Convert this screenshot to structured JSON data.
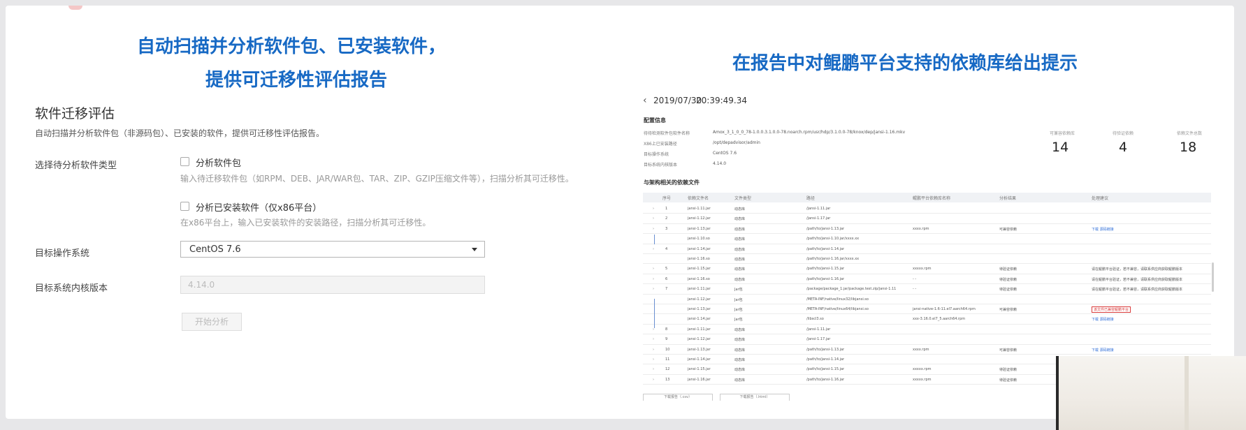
{
  "slide": {
    "left_headline_line1": "自动扫描并分析软件包、已安装软件，",
    "left_headline_line2": "提供可迁移性评估报告",
    "right_headline": "在报告中对鲲鹏平台支持的依赖库给出提示"
  },
  "form": {
    "title": "软件迁移评估",
    "description": "自动扫描并分析软件包（非源码包）、已安装的软件，提供可迁移性评估报告。",
    "type_label": "选择待分析软件类型",
    "option1_label": "分析软件包",
    "option1_hint": "输入待迁移软件包（如RPM、DEB、JAR/WAR包、TAR、ZIP、GZIP压缩文件等），扫描分析其可迁移性。",
    "option2_label": "分析已安装软件（仅x86平台）",
    "option2_hint": "在x86平台上，输入已安装软件的安装路径，扫描分析其可迁移性。",
    "os_label": "目标操作系统",
    "os_value": "CentOS 7.6",
    "kernel_label": "目标系统内核版本",
    "kernel_value": "4.14.0",
    "start_button": "开始分析"
  },
  "report": {
    "date": "2019/07/30",
    "time": "20:39:49.34",
    "config_title": "配置信息",
    "config": [
      {
        "label": "待待检测软件包软件名称",
        "value": "Amox_3_1_0_0_78-1.0.0.3.1.0.0-78.noarch.rpm/usr/hdp/3.1.0.0-78/knox/dep/jansi-1.16.mkv"
      },
      {
        "label": "X86上已安装路径",
        "value": "/opt/depadvisor/admin"
      },
      {
        "label": "目标操作系统",
        "value": "CentOS 7.6"
      },
      {
        "label": "目标系统内核版本",
        "value": "4.14.0"
      }
    ],
    "stats": [
      {
        "label": "可兼容依赖库",
        "value": "14"
      },
      {
        "label": "待验证依赖",
        "value": "4"
      },
      {
        "label": "依赖文件总数",
        "value": "18"
      }
    ],
    "table_title": "与架构相关的依赖文件",
    "columns": [
      "序号",
      "依赖文件名",
      "文件类型",
      "路径",
      "鲲鹏平台依赖库名称",
      "分析结果",
      "处理建议"
    ],
    "rows": [
      {
        "no": "1",
        "name": "jansi-1.11.jar",
        "type": "动态库",
        "path": "/jansi-1.11.jar",
        "lib": "",
        "result": "",
        "advice": ""
      },
      {
        "no": "2",
        "name": "jansi-1.12.jar",
        "type": "动态库",
        "path": "/jansi-1.17.jar",
        "lib": "",
        "result": "",
        "advice": ""
      },
      {
        "no": "3",
        "name": "jansi-1.13.jar",
        "type": "动态库",
        "path": "/path/to/jansi-1.13.jar",
        "lib": "xxxx.rpm",
        "result": "可兼容依赖",
        "advice": "下载  源码链接"
      },
      {
        "no": "",
        "name": "jansi-1.10.so",
        "type": "动态库",
        "path": "/path/to/jansi-1.10.jar/xxxx.xx",
        "lib": "",
        "result": "",
        "advice": ""
      },
      {
        "no": "4",
        "name": "jansi-1.14.jar",
        "type": "动态库",
        "path": "/path/to/jansi-1.14.jar",
        "lib": "",
        "result": "",
        "advice": ""
      },
      {
        "no": "",
        "name": "jansi-1.16.so",
        "type": "动态库",
        "path": "/path/to/jansi-1.16.jar/xxxx.xx",
        "lib": "",
        "result": "",
        "advice": ""
      },
      {
        "no": "5",
        "name": "jansi-1.15.jar",
        "type": "动态库",
        "path": "/path/to/jansi-1.15.jar",
        "lib": "xxxxx.rpm",
        "result": "待验证依赖",
        "advice": "请在鲲鹏平台验证，若不兼容，请联系供应商获取鲲鹏版本"
      },
      {
        "no": "6",
        "name": "jansi-1.16.so",
        "type": "动态库",
        "path": "/path/to/jansi-1.16.jar",
        "lib": "- -",
        "result": "待验证依赖",
        "advice": "请在鲲鹏平台验证，若不兼容，请联系供应商获取鲲鹏版本"
      },
      {
        "no": "7",
        "name": "jansi-1.11.jar",
        "type": "Jar包",
        "path": "/package/package_1.jar/package.test.zip/jansi-1.11",
        "lib": "- -",
        "result": "待验证依赖",
        "advice": "请在鲲鹏平台验证，若不兼容，请联系供应商获取鲲鹏版本"
      },
      {
        "no": "",
        "name": "jansi-1.12.jar",
        "type": "Jar包",
        "path": "/META-INF/native/linux32/libjansi.so",
        "lib": "",
        "result": "",
        "advice": ""
      },
      {
        "no": "",
        "name": "jansi-1.13.jar",
        "type": "Jar包",
        "path": "/META-INF/native/linux64/libjansi.so",
        "lib": "jansi-native-1.6-11.el7.aarch64.rpm",
        "result": "可兼容依赖",
        "advice": ""
      },
      {
        "no": "",
        "name": "jansi-1.14.jar",
        "type": "Jar包",
        "path": "/libscl3.so",
        "lib": "xxx-3.16.0.el7_5.aarch64.rpm",
        "result": "",
        "advice": "下载  源码链接"
      },
      {
        "no": "8",
        "name": "jansi-1.11.jar",
        "type": "动态库",
        "path": "/jansi-1.11.jar",
        "lib": "",
        "result": "",
        "advice": ""
      },
      {
        "no": "9",
        "name": "jansi-1.12.jar",
        "type": "动态库",
        "path": "/jansi-1.17.jar",
        "lib": "",
        "result": "",
        "advice": ""
      },
      {
        "no": "10",
        "name": "jansi-1.13.jar",
        "type": "动态库",
        "path": "/path/to/jansi-1.13.jar",
        "lib": "xxxx.rpm",
        "result": "可兼容依赖",
        "advice": "下载  源码链接"
      },
      {
        "no": "11",
        "name": "jansi-1.14.jar",
        "type": "动态库",
        "path": "/path/to/jansi-1.14.jar",
        "lib": "",
        "result": "",
        "advice": ""
      },
      {
        "no": "12",
        "name": "jansi-1.15.jar",
        "type": "动态库",
        "path": "/path/to/jansi-1.15.jar",
        "lib": "xxxxx.rpm",
        "result": "待验证依赖",
        "advice": ""
      },
      {
        "no": "13",
        "name": "jansi-1.16.jar",
        "type": "动态库",
        "path": "/path/to/jansi-1.16.jar",
        "lib": "xxxxx.rpm",
        "result": "待验证依赖",
        "advice": ""
      }
    ],
    "highlight_note": "该文件已兼容鲲鹏平台",
    "bottom_buttons": [
      "下载报告（.csv）",
      "下载报告（.html）"
    ]
  }
}
